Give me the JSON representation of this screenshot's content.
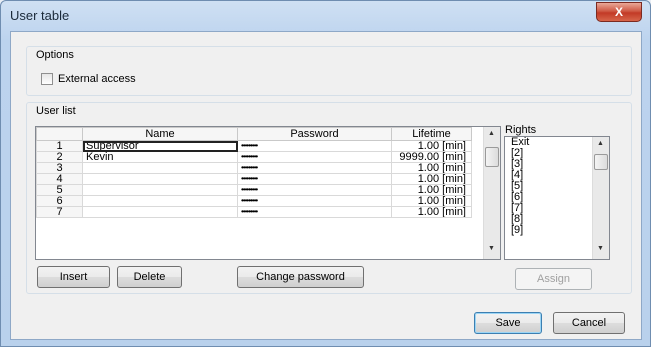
{
  "window": {
    "title": "User table",
    "close_symbol": "X"
  },
  "options": {
    "title": "Options",
    "external_access_label": "External access",
    "external_access_checked": false
  },
  "user_list": {
    "title": "User list",
    "columns": [
      "Name",
      "Password",
      "Lifetime"
    ],
    "rows": [
      {
        "num": "1",
        "name": "Supervisor",
        "password": "•••••••••",
        "lifetime": "1.00  [min]"
      },
      {
        "num": "2",
        "name": "Kevin",
        "password": "•••••••••",
        "lifetime": "9999.00  [min]"
      },
      {
        "num": "3",
        "name": "",
        "password": "•••••••••",
        "lifetime": "1.00  [min]"
      },
      {
        "num": "4",
        "name": "",
        "password": "•••••••••",
        "lifetime": "1.00  [min]"
      },
      {
        "num": "5",
        "name": "",
        "password": "•••••••••",
        "lifetime": "1.00  [min]"
      },
      {
        "num": "6",
        "name": "",
        "password": "•••••••••",
        "lifetime": "1.00  [min]"
      },
      {
        "num": "7",
        "name": "",
        "password": "•••••••••",
        "lifetime": "1.00  [min]"
      }
    ]
  },
  "rights": {
    "title": "Rights",
    "items": [
      "Exit",
      "[2]",
      "[3]",
      "[4]",
      "[5]",
      "[6]",
      "[7]",
      "[8]",
      "[9]"
    ]
  },
  "buttons": {
    "insert": "Insert",
    "delete": "Delete",
    "change_password": "Change password",
    "assign": "Assign",
    "save": "Save",
    "cancel": "Cancel"
  }
}
